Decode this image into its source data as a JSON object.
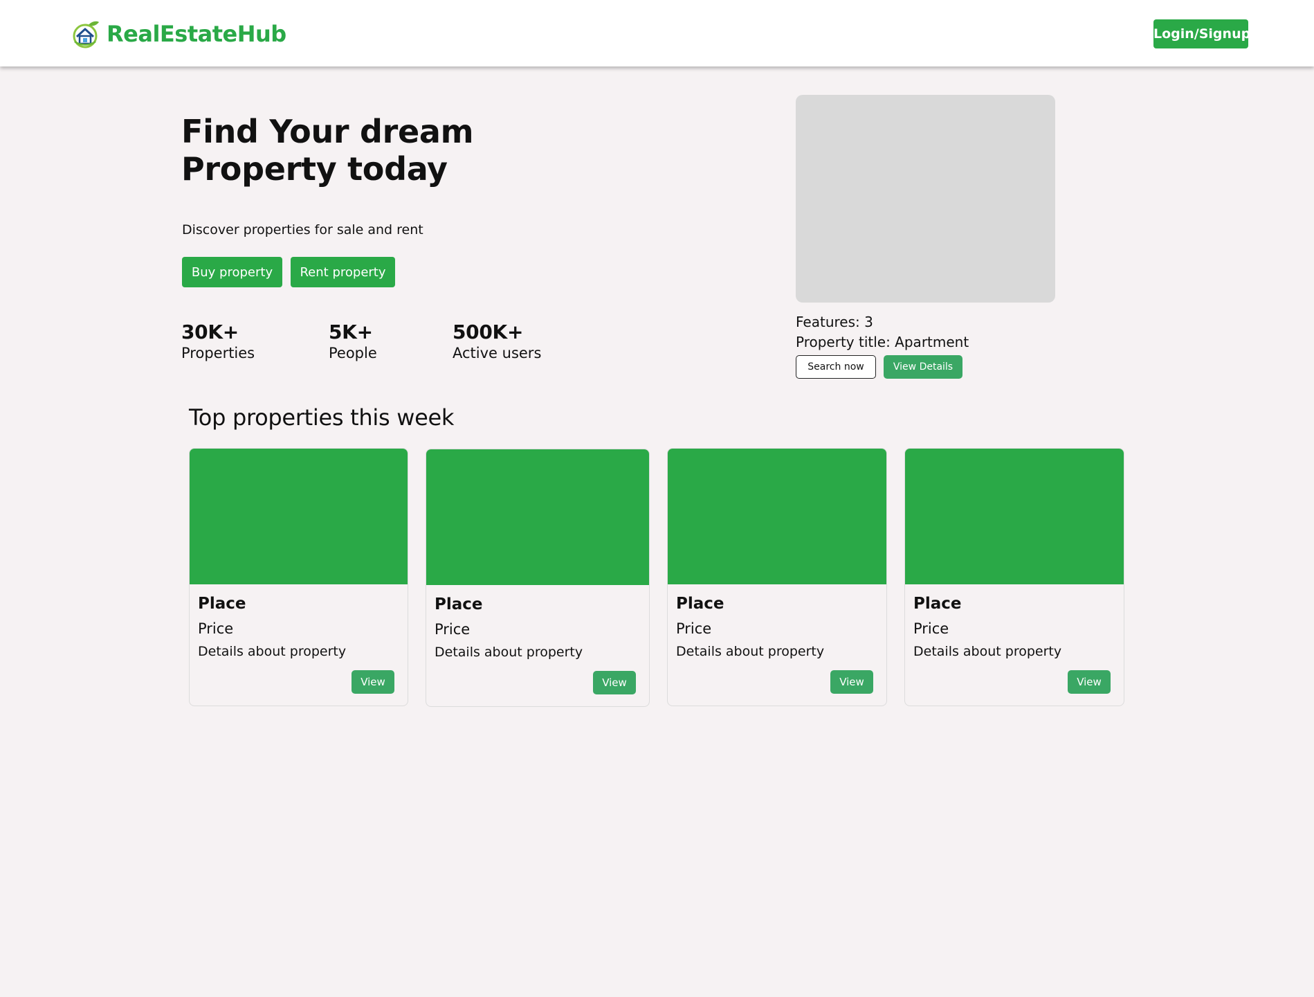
{
  "brand": {
    "name": "RealEstateHub",
    "logo_icon": "house-leaf-icon"
  },
  "nav": {
    "login_label": "Login/Signup"
  },
  "hero": {
    "title": "Find Your dream Property today",
    "subtitle": "Discover properties for sale and rent",
    "buy_label": "Buy property",
    "rent_label": "Rent property",
    "stats": [
      {
        "value": "30K+",
        "label": "Properties"
      },
      {
        "value": "5K+",
        "label": "People"
      },
      {
        "value": "500K+",
        "label": "Active users"
      }
    ]
  },
  "featured": {
    "features_label": "Features: 3",
    "title_label": "Property title: Apartment",
    "search_label": "Search now",
    "details_label": "View Details"
  },
  "top_properties": {
    "heading": "Top properties this week",
    "cards": [
      {
        "place": "Place",
        "price": "Price",
        "details": "Details about property",
        "view_label": "View"
      },
      {
        "place": "Place",
        "price": "Price",
        "details": "Details about property",
        "view_label": "View"
      },
      {
        "place": "Place",
        "price": "Price",
        "details": "Details about property",
        "view_label": "View"
      },
      {
        "place": "Place",
        "price": "Price",
        "details": "Details about property",
        "view_label": "View"
      }
    ]
  },
  "colors": {
    "brand_green": "#2aa947",
    "button_green_light": "#3aa764",
    "page_background": "#f6f2f3",
    "placeholder_gray": "#d9d9d9"
  }
}
